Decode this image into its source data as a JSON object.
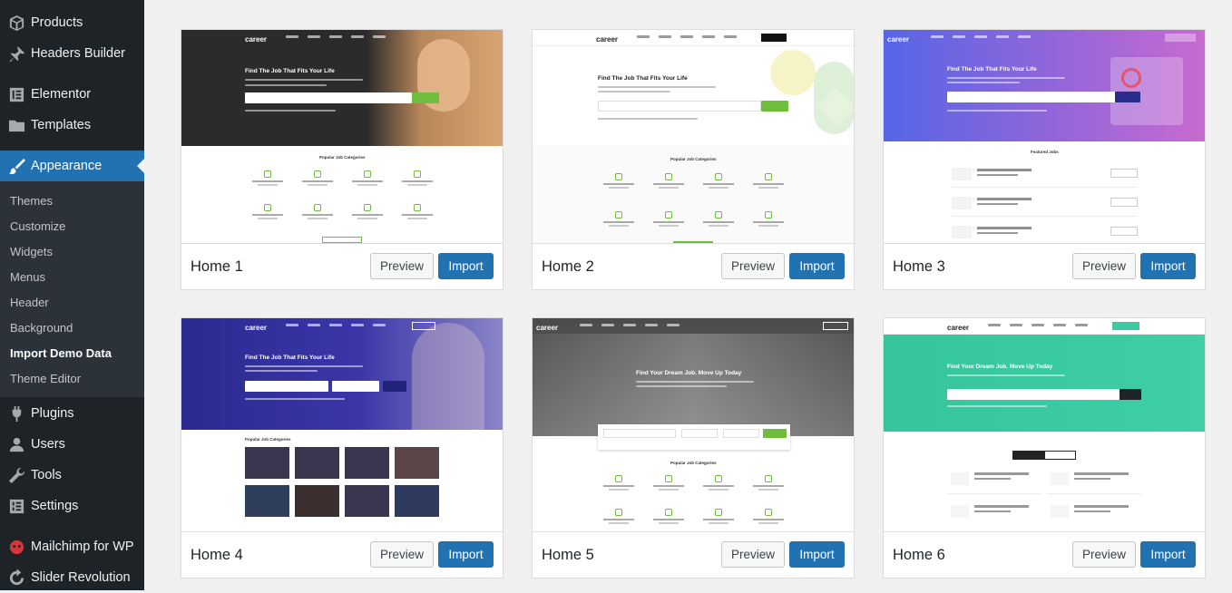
{
  "sidebar": {
    "items": [
      {
        "label": "Products",
        "icon": "products-icon"
      },
      {
        "label": "Headers Builder",
        "icon": "pin-icon"
      },
      {
        "label": "Elementor",
        "icon": "elementor-icon"
      },
      {
        "label": "Templates",
        "icon": "folder-icon"
      },
      {
        "label": "Appearance",
        "icon": "paintbrush-icon",
        "active": true
      },
      {
        "label": "Plugins",
        "icon": "plug-icon"
      },
      {
        "label": "Users",
        "icon": "users-icon"
      },
      {
        "label": "Tools",
        "icon": "wrench-icon"
      },
      {
        "label": "Settings",
        "icon": "settings-icon"
      },
      {
        "label": "Mailchimp for WP",
        "icon": "mailchimp-icon"
      },
      {
        "label": "Slider Revolution",
        "icon": "refresh-icon"
      }
    ],
    "submenu": [
      {
        "label": "Themes"
      },
      {
        "label": "Customize"
      },
      {
        "label": "Widgets"
      },
      {
        "label": "Menus"
      },
      {
        "label": "Header"
      },
      {
        "label": "Background"
      },
      {
        "label": "Import Demo Data",
        "current": true
      },
      {
        "label": "Theme Editor"
      }
    ]
  },
  "demos": [
    {
      "name": "Home 1",
      "preview_label": "Preview",
      "import_label": "Import",
      "headline": "Find The Job That Fits Your Life",
      "section": "Popular Job Categories",
      "logo": "career"
    },
    {
      "name": "Home 2",
      "preview_label": "Preview",
      "import_label": "Import",
      "headline": "Find The Job That Fits Your Life",
      "section": "Popular Job Categories",
      "logo": "career"
    },
    {
      "name": "Home 3",
      "preview_label": "Preview",
      "import_label": "Import",
      "headline": "Find The Job That Fits Your Life",
      "section": "Featured Jobs",
      "logo": "career"
    },
    {
      "name": "Home 4",
      "preview_label": "Preview",
      "import_label": "Import",
      "headline": "Find The Job That Fits Your Life",
      "section": "Popular Job Categories",
      "logo": "career"
    },
    {
      "name": "Home 5",
      "preview_label": "Preview",
      "import_label": "Import",
      "headline": "Find Your Dream Job. Move Up Today",
      "section": "Popular Job Categories",
      "logo": "career"
    },
    {
      "name": "Home 6",
      "preview_label": "Preview",
      "import_label": "Import",
      "headline": "Find Your Dream Job. Move Up Today",
      "section": "",
      "logo": "career"
    }
  ],
  "colors": {
    "sidebar_bg": "#1d2327",
    "submenu_bg": "#2c3338",
    "active_blue": "#2271b1",
    "career_green": "#6ebd3c"
  }
}
